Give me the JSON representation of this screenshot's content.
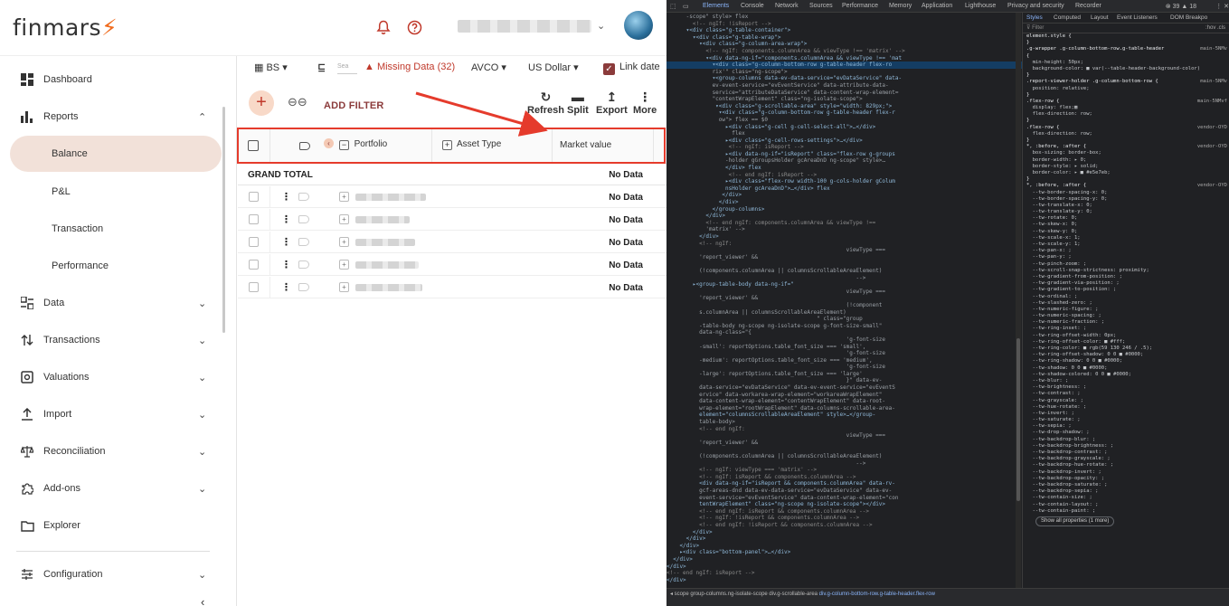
{
  "app": {
    "logo_text": "finmars",
    "accent": "#f06b1e",
    "brand_dark": "#8b3b3b",
    "active_bg": "#f2e1d9",
    "header_icons": [
      "bell-icon",
      "help-icon"
    ],
    "user_chevron": "⌄",
    "sidebar": {
      "items": [
        {
          "label": "Dashboard",
          "icon": "dashboard-icon",
          "chevron": ""
        },
        {
          "label": "Reports",
          "icon": "reports-icon",
          "chevron": "⌃"
        },
        {
          "label": "Data",
          "icon": "data-icon",
          "chevron": "⌄"
        },
        {
          "label": "Transactions",
          "icon": "transactions-icon",
          "chevron": "⌄"
        },
        {
          "label": "Valuations",
          "icon": "valuations-icon",
          "chevron": "⌄"
        },
        {
          "label": "Import",
          "icon": "import-icon",
          "chevron": "⌄"
        },
        {
          "label": "Reconciliation",
          "icon": "reconciliation-icon",
          "chevron": "⌄"
        },
        {
          "label": "Add-ons",
          "icon": "addons-icon",
          "chevron": "⌄"
        },
        {
          "label": "Explorer",
          "icon": "explorer-icon",
          "chevron": ""
        },
        {
          "label": "Configuration",
          "icon": "configuration-icon",
          "chevron": "⌄"
        }
      ],
      "sub_items": [
        "Balance",
        "P&L",
        "Transaction",
        "Performance"
      ],
      "active_sub": "Balance",
      "collapse_glyph": "‹"
    },
    "toolbar1": {
      "layout_label": "BS",
      "search_placeholder": "Sea",
      "missing_data": "Missing Data (32)",
      "cost_method": "AVCO",
      "currency": "US Dollar",
      "link_date": "Link date"
    },
    "toolbar2": {
      "add_filter": "ADD FILTER",
      "actions": [
        {
          "label": "Refresh",
          "glyph": "↻"
        },
        {
          "label": "Split",
          "glyph": "▬"
        },
        {
          "label": "Export",
          "glyph": "↥"
        },
        {
          "label": "More",
          "glyph": "⋮"
        }
      ]
    },
    "grid": {
      "columns": [
        "Portfolio",
        "Asset Type",
        "Market value"
      ],
      "grand_total": "GRAND TOTAL",
      "no_data": "No Data",
      "rows": [
        {
          "value": "No Data"
        },
        {
          "value": "No Data"
        },
        {
          "value": "No Data"
        },
        {
          "value": "No Data"
        },
        {
          "value": "No Data"
        }
      ]
    }
  },
  "devtools": {
    "tabs": [
      "Elements",
      "Console",
      "Network",
      "Sources",
      "Performance",
      "Memory",
      "Application",
      "Lighthouse",
      "Privacy and security",
      "Recorder"
    ],
    "active_tab": "Elements",
    "badges": "⊗ 39 ▲ 18",
    "style_tabs": [
      "Styles",
      "Computed",
      "Layout",
      "Event Listeners",
      "DOM Breakpo"
    ],
    "filter_placeholder": "Filter",
    "filter_right": ":hov .cls",
    "show_all": "Show all properties (1 more)",
    "breadcrumbs": [
      "scope",
      "group-columns.ng-isolate-scope",
      "div.g-scrollable-area",
      "div.g-column-bottom-row.g-table-header.flex-row"
    ],
    "highlight_line": 7,
    "element_lines": [
      "      -scope\" style> flex",
      "        <!-- ngIf: !isReport -->",
      "      ▾<div class=\"g-table-container\">",
      "        ▾<div class=\"g-table-wrap\">",
      "          ▾<div class=\"g-column-area-wrap\">",
      "            <!-- ngIf: components.columnArea && viewType !== 'matrix' -->",
      "            ▾<div data-ng-if=\"components.columnArea && viewType !== 'mat",
      "              ▾<div class=\"g-column-bottom-row g-table-header flex-ro",
      "              rix'\" class=\"ng-scope\">",
      "              ▾<group-columns data-ev-data-service=\"evDataService\" data-",
      "              ev-event-service=\"evEventService\" data-attribute-data-",
      "              service=\"attributeDataService\" data-content-wrap-element=",
      "              \"contentWrapElement\" class=\"ng-isolate-scope\">",
      "               ▾<div class=\"g-scrollable-area\" style=\"width: 829px;\">",
      "                ▾<div class=\"g-column-bottom-row g-table-header flex-r",
      "                ow\"> flex == $0",
      "                  ▸<div class=\"g-cell g-cell-select-all\">…</div>",
      "                    flex",
      "                  ▸<div class=\"g-cell-rows-settings\">…</div>",
      "                   <!-- ngIf: isReport -->",
      "                  ▸<div data-ng-if=\"isReport\" class=\"flex-row g-groups",
      "                  -holder gGroupsHolder gcAreaDnD ng-scope\" style>…",
      "                  </div> flex",
      "                   <!-- end ngIf: isReport -->",
      "                  ▸<div class=\"flex-row width-100 g-cols-holder gColum",
      "                  nsHolder gcAreaDnD\">…</div> flex",
      "                 </div>",
      "                </div>",
      "              </group-columns>",
      "            </div>",
      "            <!-- end ngIf: components.columnArea && viewType !==",
      "            'matrix' -->",
      "          </div>",
      "          <!-- ngIf:",
      "                                                       viewType ===",
      "          'report_viewer' &&",
      "",
      "          (!components.columnArea || columnsScrollableAreaElement)",
      "                                                          -->",
      "        ▸<group-table-body data-ng-if=\"",
      "                                                       viewType ===",
      "          'report_viewer' &&",
      "                                                       (!component",
      "          s.columnArea || columnsScrollableAreaElement)",
      "                                              \" class=\"group",
      "          -table-body ng-scope ng-isolate-scope g-font-size-small\"",
      "          data-ng-class=\"{",
      "                                                       'g-font-size",
      "          -small': reportOptions.table_font_size === 'small',",
      "                                                       'g-font-size",
      "          -medium': reportOptions.table_font_size === 'medium',",
      "                                                       'g-font-size",
      "          -large': reportOptions.table_font_size === 'large'",
      "                                                       }\" data-ev-",
      "          data-service=\"evDataService\" data-ev-event-service=\"evEventS",
      "          ervice\" data-workarea-wrap-element=\"workareaWrapElement\"",
      "          data-content-wrap-element=\"contentWrapElement\" data-root-",
      "          wrap-element=\"rootWrapElement\" data-columns-scrollable-area-",
      "          element=\"columnsScrollableAreaElement\" style>…</group-",
      "          table-body>",
      "          <!-- end ngIf:",
      "                                                       viewType ===",
      "          'report_viewer' &&",
      "",
      "          (!components.columnArea || columnsScrollableAreaElement)",
      "                                                          -->",
      "          <!-- ngIf: viewType === 'matrix' -->",
      "          <!-- ngIf: isReport && components.columnArea -->",
      "          <div data-ng-if=\"isReport && components.columnArea\" data-rv-",
      "          gcf-areas-dnd data-ev-data-service=\"evDataService\" data-ev-",
      "          event-service=\"evEventService\" data-content-wrap-element=\"con",
      "          tentWrapElement\" class=\"ng-scope ng-isolate-scope\"></div>",
      "          <!-- end ngIf: isReport && components.columnArea -->",
      "          <!-- ngIf: !isReport && components.columnArea -->",
      "          <!-- end ngIf: !isReport && components.columnArea -->",
      "        </div>",
      "      </div>",
      "    </div>",
      "    ▸<div class=\"bottom-panel\">…</div>",
      "  </div>",
      "</div>",
      "<!-- end ngIf: isReport -->",
      "</div>"
    ],
    "style_lines": [
      {
        "text": "element.style {",
        "src": ""
      },
      {
        "text": "}",
        "src": ""
      },
      {
        "text": ".g-wrapper .g-column-bottom-row.g-table-header",
        "src": "main-5NMv"
      },
      {
        "text": "{",
        "src": ""
      },
      {
        "text": "  min-height: 50px;",
        "src": ""
      },
      {
        "text": "  background-color: ■ var(--table-header-background-color)",
        "src": ""
      },
      {
        "text": "}",
        "src": ""
      },
      {
        "text": ".report-viewer-holder .g-column-bottom-row {",
        "src": "main-5NMv"
      },
      {
        "text": "  position: relative;",
        "src": ""
      },
      {
        "text": "}",
        "src": ""
      },
      {
        "text": ".flex-row {",
        "src": "main-5NMvf"
      },
      {
        "text": "  display: flex;▦",
        "src": ""
      },
      {
        "text": "  flex-direction: row;",
        "src": ""
      },
      {
        "text": "}",
        "src": ""
      },
      {
        "text": ".flex-row {",
        "src": "vendor-OYD"
      },
      {
        "text": "  flex-direction: row;",
        "src": ""
      },
      {
        "text": "}",
        "src": ""
      },
      {
        "text": "*, :before, :after {",
        "src": "vendor-OYD"
      },
      {
        "text": "  box-sizing: border-box;",
        "src": ""
      },
      {
        "text": "  border-width: ▸ 0;",
        "src": ""
      },
      {
        "text": "  border-style: ▸ solid;",
        "src": ""
      },
      {
        "text": "  border-color: ▸ ■ #e5e7eb;",
        "src": ""
      },
      {
        "text": "}",
        "src": ""
      },
      {
        "text": "*, :before, :after {",
        "src": "vendor-OYD"
      },
      {
        "text": "  --tw-border-spacing-x: 0;",
        "src": ""
      },
      {
        "text": "  --tw-border-spacing-y: 0;",
        "src": ""
      },
      {
        "text": "  --tw-translate-x: 0;",
        "src": ""
      },
      {
        "text": "  --tw-translate-y: 0;",
        "src": ""
      },
      {
        "text": "  --tw-rotate: 0;",
        "src": ""
      },
      {
        "text": "  --tw-skew-x: 0;",
        "src": ""
      },
      {
        "text": "  --tw-skew-y: 0;",
        "src": ""
      },
      {
        "text": "  --tw-scale-x: 1;",
        "src": ""
      },
      {
        "text": "  --tw-scale-y: 1;",
        "src": ""
      },
      {
        "text": "  --tw-pan-x: ;",
        "src": ""
      },
      {
        "text": "  --tw-pan-y: ;",
        "src": ""
      },
      {
        "text": "  --tw-pinch-zoom: ;",
        "src": ""
      },
      {
        "text": "  --tw-scroll-snap-strictness: proximity;",
        "src": ""
      },
      {
        "text": "  --tw-gradient-from-position: ;",
        "src": ""
      },
      {
        "text": "  --tw-gradient-via-position: ;",
        "src": ""
      },
      {
        "text": "  --tw-gradient-to-position: ;",
        "src": ""
      },
      {
        "text": "  --tw-ordinal: ;",
        "src": ""
      },
      {
        "text": "  --tw-slashed-zero: ;",
        "src": ""
      },
      {
        "text": "  --tw-numeric-figure: ;",
        "src": ""
      },
      {
        "text": "  --tw-numeric-spacing: ;",
        "src": ""
      },
      {
        "text": "  --tw-numeric-fraction: ;",
        "src": ""
      },
      {
        "text": "  --tw-ring-inset: ;",
        "src": ""
      },
      {
        "text": "  --tw-ring-offset-width: 0px;",
        "src": ""
      },
      {
        "text": "  --tw-ring-offset-color: ■ #fff;",
        "src": ""
      },
      {
        "text": "  --tw-ring-color: ■ rgb(59 130 246 / .5);",
        "src": ""
      },
      {
        "text": "  --tw-ring-offset-shadow: 0 0 ■ #0000;",
        "src": ""
      },
      {
        "text": "  --tw-ring-shadow: 0 0 ■ #0000;",
        "src": ""
      },
      {
        "text": "  --tw-shadow: 0 0 ■ #0000;",
        "src": ""
      },
      {
        "text": "  --tw-shadow-colored: 0 0 ■ #0000;",
        "src": ""
      },
      {
        "text": "  --tw-blur: ;",
        "src": ""
      },
      {
        "text": "  --tw-brightness: ;",
        "src": ""
      },
      {
        "text": "  --tw-contrast: ;",
        "src": ""
      },
      {
        "text": "  --tw-grayscale: ;",
        "src": ""
      },
      {
        "text": "  --tw-hue-rotate: ;",
        "src": ""
      },
      {
        "text": "  --tw-invert: ;",
        "src": ""
      },
      {
        "text": "  --tw-saturate: ;",
        "src": ""
      },
      {
        "text": "  --tw-sepia: ;",
        "src": ""
      },
      {
        "text": "  --tw-drop-shadow: ;",
        "src": ""
      },
      {
        "text": "  --tw-backdrop-blur: ;",
        "src": ""
      },
      {
        "text": "  --tw-backdrop-brightness: ;",
        "src": ""
      },
      {
        "text": "  --tw-backdrop-contrast: ;",
        "src": ""
      },
      {
        "text": "  --tw-backdrop-grayscale: ;",
        "src": ""
      },
      {
        "text": "  --tw-backdrop-hue-rotate: ;",
        "src": ""
      },
      {
        "text": "  --tw-backdrop-invert: ;",
        "src": ""
      },
      {
        "text": "  --tw-backdrop-opacity: ;",
        "src": ""
      },
      {
        "text": "  --tw-backdrop-saturate: ;",
        "src": ""
      },
      {
        "text": "  --tw-backdrop-sepia: ;",
        "src": ""
      },
      {
        "text": "  --tw-contain-size: ;",
        "src": ""
      },
      {
        "text": "  --tw-contain-layout: ;",
        "src": ""
      },
      {
        "text": "  --tw-contain-paint: ;",
        "src": ""
      }
    ]
  }
}
